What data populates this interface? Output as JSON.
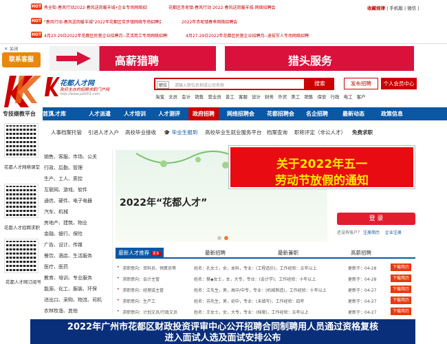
{
  "topbar": {
    "hot": "HOT",
    "ann": [
      "秀全街-春风行动2022-春风送岗暖羊城•企业专场网络招聘会",
      "花都区赤坭镇-春风行动 2022-春风送岗暖羊城-网络招聘会",
      "\"春风行动-春风送岗暖羊城\"2022年花都区炭步镇网络专场招聘会",
      "2022年赤坭镇春季网络招聘会",
      "4月23-29日2022年花都区民营企业招聘月--灵活用工专场网络招聘会",
      "4月27-29日2022年花都区民营企业招聘月--退役军人专场网络招聘会"
    ],
    "links": {
      "favorite": "收藏规律",
      "sep1": "|",
      "mobile": "手机版",
      "sep2": "|",
      "wechat": "微信",
      "sep3": "|"
    }
  },
  "left": {
    "close": "关闭",
    "kefu": "联系客服",
    "platform": "专技继教平台",
    "qr1_label": "花都人才网络课堂",
    "qr2_label": "花都人才招聘求职",
    "qr3_label": "花都人才网订阅号"
  },
  "banners": {
    "b1": "高薪猎聘",
    "b2": "猎头服务"
  },
  "logo": {
    "name": "花都人才网",
    "slogan": "政府主办的招聘求职门户网",
    "url": "http://www.job001.com"
  },
  "search": {
    "select": "职位",
    "placeholder": "请输入职位名称或公司名称",
    "button": "搜索",
    "hot": [
      "淘宝",
      "文员",
      "会计",
      "销售",
      "营业员",
      "普工",
      "客服",
      "设计",
      "财务",
      "外贸",
      "美工",
      "销售",
      "保安",
      "行政",
      "电工",
      "客户"
    ]
  },
  "buttons": {
    "publish": "发布招聘",
    "center": "个人会员中心"
  },
  "nav": [
    "首页",
    "人才库",
    "人才派遣",
    "人才培训",
    "人才测评",
    "政府招聘",
    "网络招聘会",
    "花都招聘会",
    "名企招聘",
    "最新动态",
    "政策信息"
  ],
  "subnav": [
    "人事档案托管",
    "引进人才入户",
    "高校毕业接收",
    "毕业生报到",
    "高校毕业生就业服务平台",
    "档案查询",
    "职称评定（非公人才）",
    "免费求职"
  ],
  "categories": [
    "销售、客服、市场、公关",
    "行政、后勤、管理",
    "生产、工人、质控",
    "互联网、游戏、软件",
    "通信、硬件、电子电器",
    "汽车、机械",
    "房地产、建筑、物业",
    "金融、银行、保险",
    "广告、设计、传媒",
    "餐饮、酒店、生活服务",
    "医疗、医药",
    "教育、培训、专业服务",
    "能源、化工、服装、环保",
    "进出口、采购、物流、司机",
    "农林牧渔、其他"
  ],
  "slider": {
    "text": "2022年“花都人才”"
  },
  "popup": {
    "line1": "关于2022年五一",
    "line2": "劳动节放假的通知"
  },
  "login": {
    "button": "登 录",
    "no_account": "还没有账户？",
    "register": "注册简历",
    "corp": "企业注册"
  },
  "tabs": {
    "t1": "最新人才推荐",
    "more": "更多",
    "t2": "最新招聘",
    "t3": "最新兼职",
    "t4": "高薪招聘"
  },
  "rows": [
    {
      "intent": "求职意向：资料员、预算员等",
      "person": "姓名：孔女士，女，本科，专业：(工程造价)，工作经验：五年以上",
      "date": "更新于：04-28",
      "badge": "下载简历"
    },
    {
      "intent": "求职意向：会计主管",
      "person": "姓名：樊◆女士，女，大专，专业：(会计学)，工作经验：十年以上",
      "date": "更新于：04-28",
      "badge": "下载简历"
    },
    {
      "intent": "求职意向：经理或主管",
      "person": "姓名：江先生，男，高中/中专，专业：(机械制造)，工作经验：十年以上",
      "date": "更新于：04-27",
      "badge": "下载简历"
    },
    {
      "intent": "求职意向：生产工",
      "person": "姓名：苏先生，男，初中，专业：(未填写)，工作经验：四年",
      "date": "更新于：04-27",
      "badge": "下载简历"
    },
    {
      "intent": "求职意向：计划文员/行政文员",
      "person": "姓名：王女士，女，大专，专业：(档案)，工作经验：五年以上",
      "date": "更新于：04-27",
      "badge": "下载简历"
    }
  ],
  "bottom": {
    "line1": "2022年广州市花都区财政投资评审中心公开招聘合同制聘用人员通过资格复核",
    "line2": "进入面试人选及面试安排公布"
  },
  "colors": {
    "red": "#c00000",
    "blue": "#0a57a4",
    "yellow": "#ffea00"
  }
}
